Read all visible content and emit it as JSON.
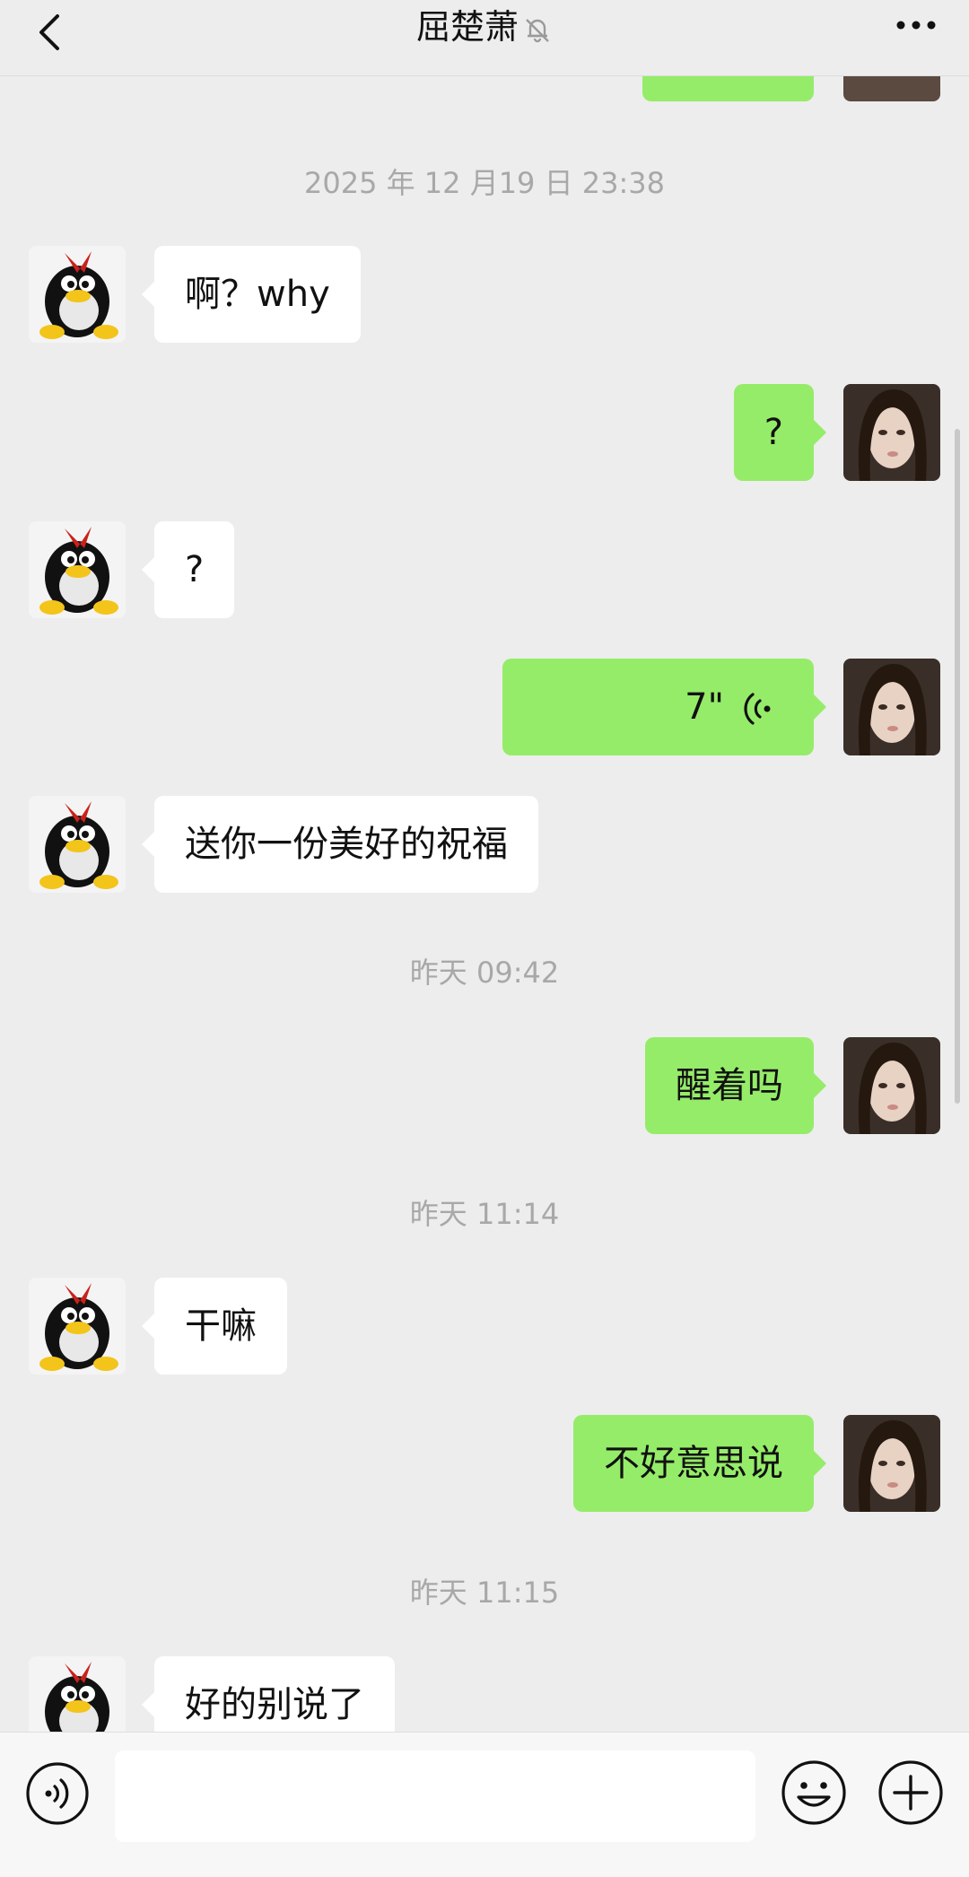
{
  "header": {
    "title": "屈楚萧",
    "back_icon": "chevron-left-icon",
    "mute_icon": "bell-off-icon",
    "more_icon": "more-dots-icon"
  },
  "messages": [
    {
      "type": "time",
      "text": "2025 年 12 月19 日 23:38"
    },
    {
      "type": "in",
      "text": "啊？why"
    },
    {
      "type": "out",
      "text": "?"
    },
    {
      "type": "in",
      "text": "?"
    },
    {
      "type": "out-voice",
      "duration": "7\""
    },
    {
      "type": "in",
      "text": "送你一份美好的祝福"
    },
    {
      "type": "time",
      "text": "昨天 09:42"
    },
    {
      "type": "out",
      "text": "醒着吗"
    },
    {
      "type": "time",
      "text": "昨天 11:14"
    },
    {
      "type": "in",
      "text": "干嘛"
    },
    {
      "type": "out",
      "text": "不好意思说"
    },
    {
      "type": "time",
      "text": "昨天 11:15"
    },
    {
      "type": "in",
      "text": "好的别说了"
    }
  ],
  "avatars": {
    "contact": "penguin-avatar",
    "self": "portrait-avatar"
  },
  "bottom_bar": {
    "voice_icon": "voice-input-icon",
    "emoji_icon": "emoji-icon",
    "plus_icon": "plus-icon",
    "input_value": ""
  },
  "colors": {
    "background": "#ededed",
    "outgoing_bubble": "#95ec69",
    "incoming_bubble": "#ffffff",
    "timestamp": "#a8a8a8"
  }
}
